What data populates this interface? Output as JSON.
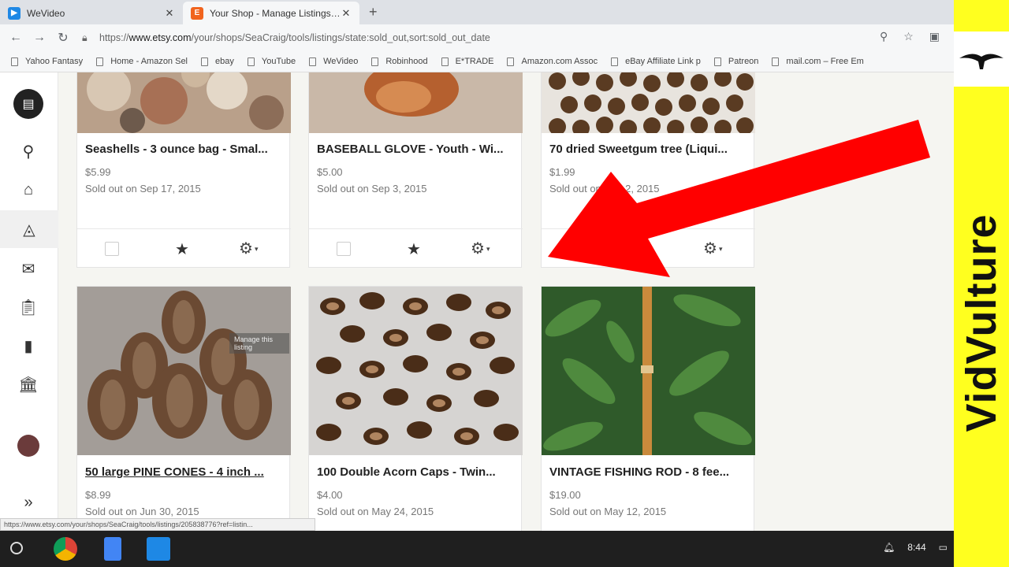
{
  "browser": {
    "tabs": [
      {
        "title": "WeVideo",
        "active": false
      },
      {
        "title": "Your Shop - Manage Listings - Et",
        "active": true
      }
    ],
    "url": {
      "prefix": "https://",
      "domain": "www.etsy.com",
      "path": "/your/shops/SeaCraig/tools/listings/state:sold_out,sort:sold_out_date"
    },
    "bookmarks": [
      "Yahoo Fantasy",
      "Home - Amazon Sel",
      "ebay",
      "YouTube",
      "WeVideo",
      "Robinhood",
      "E*TRADE",
      "Amazon.com Assoc",
      "eBay Affiliate Link p",
      "Patreon",
      "mail.com – Free Em"
    ],
    "status_url": "https://www.etsy.com/your/shops/SeaCraig/tools/listings/205838776?ref=listin..."
  },
  "listings": [
    {
      "title": "Seashells - 3 ounce bag - Smal...",
      "price": "$5.99",
      "sold": "Sold out on Sep 17, 2015"
    },
    {
      "title": "BASEBALL GLOVE - Youth - Wi...",
      "price": "$5.00",
      "sold": "Sold out on Sep 3, 2015"
    },
    {
      "title": "70 dried Sweetgum tree (Liqui...",
      "price": "$1.99",
      "sold": "Sold out on Sep 2, 2015"
    },
    {
      "title": "50 large PINE CONES - 4 inch ...",
      "price": "$8.99",
      "sold": "Sold out on Jun 30, 2015"
    },
    {
      "title": "100 Double Acorn Caps - Twin...",
      "price": "$4.00",
      "sold": "Sold out on May 24, 2015"
    },
    {
      "title": "VINTAGE FISHING ROD - 8 fee...",
      "price": "$19.00",
      "sold": "Sold out on May 12, 2015"
    }
  ],
  "tooltip": "Manage this listing",
  "taskbar": {
    "time": "8:44"
  },
  "banner": {
    "text": "VidVulture"
  },
  "colors": {
    "arrow": "#ff0000",
    "banner": "#ffff1f"
  }
}
